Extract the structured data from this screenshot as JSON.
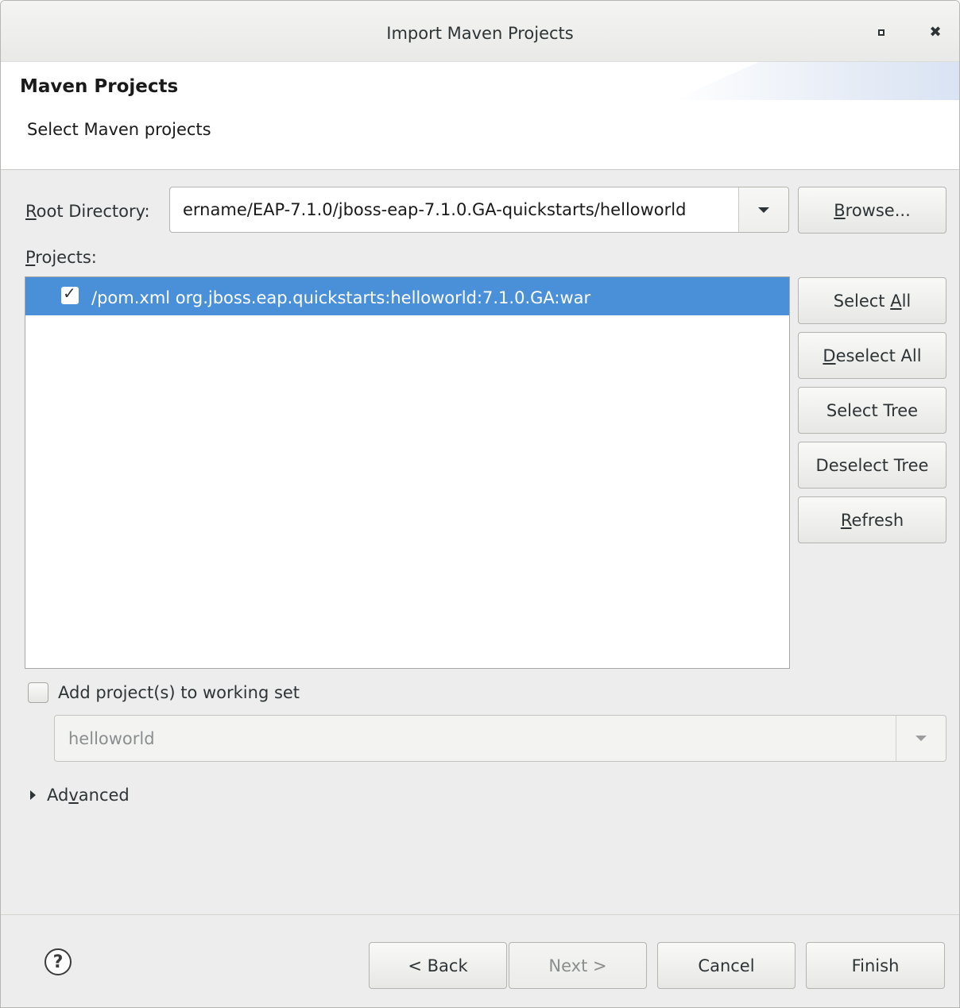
{
  "window": {
    "title": "Import Maven Projects",
    "maximize_icon": "maximize-icon",
    "close_icon": "close-icon"
  },
  "header": {
    "title": "Maven Projects",
    "subtitle": "Select Maven projects"
  },
  "root_directory": {
    "label_mnemonic": "R",
    "label_rest": "oot Directory:",
    "value": "ername/EAP-7.1.0/jboss-eap-7.1.0.GA-quickstarts/helloworld",
    "browse_mnemonic": "B",
    "browse_rest": "rowse..."
  },
  "projects": {
    "label_mnemonic": "P",
    "label_rest": "rojects:",
    "items": [
      {
        "checked": true,
        "text": "/pom.xml  org.jboss.eap.quickstarts:helloworld:7.1.0.GA:war",
        "selected": true
      }
    ]
  },
  "side_buttons": {
    "select_all_pre": "Select ",
    "select_all_mnemonic": "A",
    "select_all_post": "ll",
    "deselect_all_mnemonic": "D",
    "deselect_all_rest": "eselect All",
    "select_tree": "Select Tree",
    "deselect_tree": "Deselect Tree",
    "refresh_mnemonic": "R",
    "refresh_rest": "efresh"
  },
  "working_set": {
    "checkbox_label": "Add project(s) to working set",
    "checked": false,
    "value": "helloworld"
  },
  "advanced": {
    "pre": "Ad",
    "mnemonic": "v",
    "post": "anced",
    "expanded": false
  },
  "footer": {
    "help_icon": "help-icon",
    "back": "< Back",
    "next": "Next >",
    "cancel": "Cancel",
    "finish": "Finish"
  }
}
